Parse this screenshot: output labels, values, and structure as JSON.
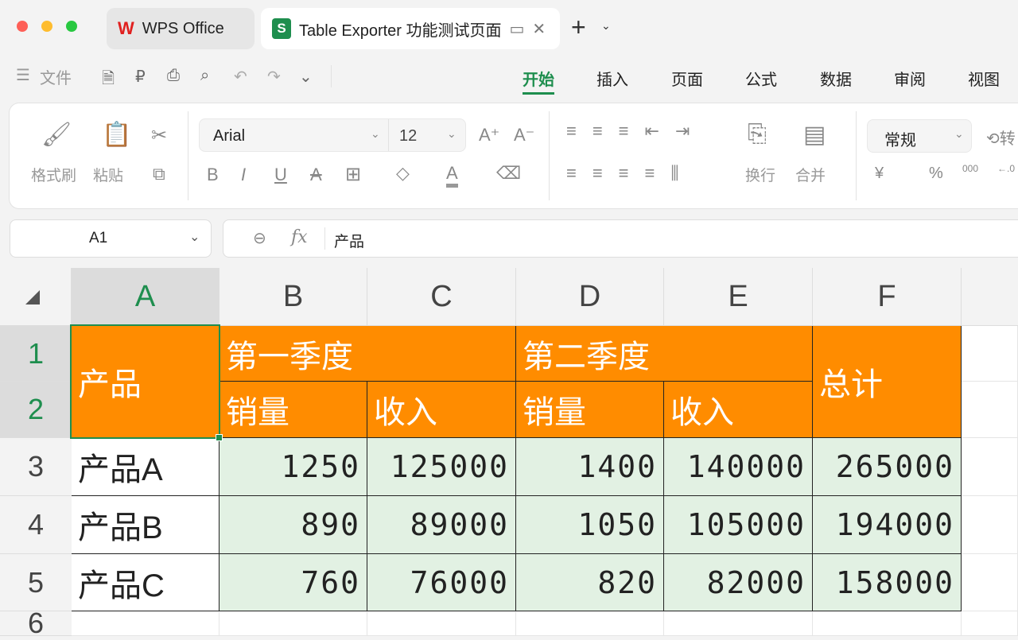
{
  "window": {
    "tabs": [
      {
        "label": "WPS Office",
        "icon": "wps-logo-icon"
      },
      {
        "label": "Table Exporter 功能测试页面",
        "icon": "sheet-s-icon"
      }
    ],
    "new_tab": "+"
  },
  "menu": {
    "file": "文件"
  },
  "ribbon_tabs": [
    "开始",
    "插入",
    "页面",
    "公式",
    "数据",
    "审阅",
    "视图"
  ],
  "active_tab": "开始",
  "ribbon": {
    "format_painter": "格式刷",
    "paste": "粘贴",
    "font": "Arial",
    "font_size": "12",
    "wrap": "换行",
    "merge": "合并",
    "number_format": "常规",
    "convert": "转",
    "currency": "¥",
    "percent": "%",
    "thousands": "000",
    "decimal": "←.0"
  },
  "formula_bar": {
    "cell_ref": "A1",
    "fx": "fx",
    "value": "产品"
  },
  "colors": {
    "header_fill": "#ff8c00",
    "data_fill": "#e2f1e3",
    "selection": "#1e8e4e"
  },
  "columns": [
    "A",
    "B",
    "C",
    "D",
    "E",
    "F"
  ],
  "rows": [
    "1",
    "2",
    "3",
    "4",
    "5",
    "6"
  ],
  "table": {
    "product_header": "产品",
    "q1": "第一季度",
    "q2": "第二季度",
    "total": "总计",
    "sub": [
      "销量",
      "收入",
      "销量",
      "收入"
    ],
    "data": [
      [
        "产品A",
        "1250",
        "125000",
        "1400",
        "140000",
        "265000"
      ],
      [
        "产品B",
        "890",
        "89000",
        "1050",
        "105000",
        "194000"
      ],
      [
        "产品C",
        "760",
        "76000",
        "820",
        "82000",
        "158000"
      ]
    ]
  }
}
